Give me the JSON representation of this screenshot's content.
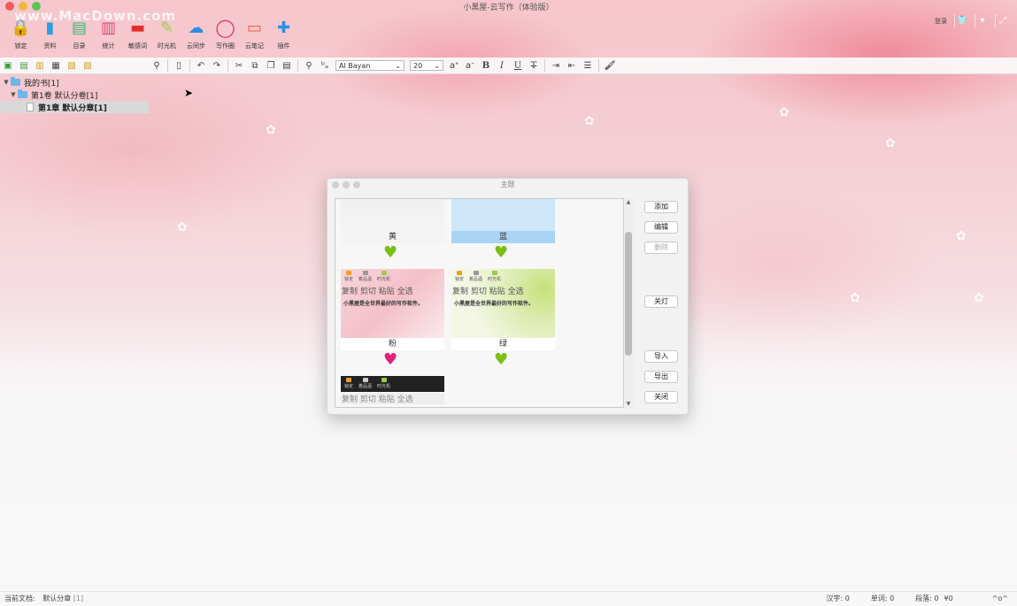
{
  "window": {
    "title": "小黑屋-云写作（体验版）",
    "watermark": "www.MacDown.com"
  },
  "ribbon": [
    {
      "label": "锁定",
      "icon": "lock-icon",
      "color": "#f0a020"
    },
    {
      "label": "资料",
      "icon": "book-icon",
      "color": "#2aa0e0"
    },
    {
      "label": "目录",
      "icon": "list-icon",
      "color": "#3cb878"
    },
    {
      "label": "统计",
      "icon": "stats-icon",
      "color": "#e0457a"
    },
    {
      "label": "敏感词",
      "icon": "sensitive-icon",
      "color": "#e03030"
    },
    {
      "label": "时光机",
      "icon": "time-machine-icon",
      "color": "#9ccc4a"
    },
    {
      "label": "云同步",
      "icon": "cloud-icon",
      "color": "#2a8fe0"
    },
    {
      "label": "写作圈",
      "icon": "circle-icon",
      "color": "#e0306a"
    },
    {
      "label": "云笔记",
      "icon": "note-icon",
      "color": "#f06030"
    },
    {
      "label": "插件",
      "icon": "plus-icon",
      "color": "#2a8fe0"
    }
  ],
  "topright": {
    "login": "登录"
  },
  "toolbar": {
    "font": "Al Bayan",
    "size": "20"
  },
  "tree": [
    {
      "label": "我的书[1]",
      "level": 0
    },
    {
      "label": "第1卷 默认分卷[1]",
      "level": 1
    },
    {
      "label": "第1章 默认分章[1]",
      "level": 2
    }
  ],
  "dialog": {
    "title": "主题",
    "themes": [
      {
        "name": "黄",
        "heart": "#7ac014"
      },
      {
        "name": "蓝",
        "heart": "#7ac014"
      },
      {
        "name": "粉",
        "heart": "#e0207a",
        "edit": "复制 剪切 粘贴 全选",
        "sample": "小黑屋是全世界最好的写作软件。",
        "mini": [
          "锁定",
          "着品酒",
          "时光机"
        ]
      },
      {
        "name": "绿",
        "heart": "#7ac014",
        "edit": "复制 剪切 粘贴 全选",
        "sample": "小黑屋是全世界最好的写作软件。",
        "mini": [
          "锁定",
          "着品酒",
          "时光机"
        ]
      },
      {
        "name": "",
        "edit": "复制 剪切 粘贴 全选",
        "mini": [
          "锁定",
          "着品酒",
          "时光机"
        ]
      }
    ],
    "buttons": {
      "add": "添加",
      "edit": "编辑",
      "delete": "删除",
      "lights_off": "关灯",
      "import": "导入",
      "export": "导出",
      "close": "关闭"
    }
  },
  "status": {
    "current_doc_label": "当前文档:",
    "current_doc": "默认分章",
    "current_doc_count": "[1]",
    "chars": "汉字: 0",
    "words": "单词: 0",
    "paragraphs": "段落: 0",
    "money": "¥0",
    "emote": "^o^"
  }
}
